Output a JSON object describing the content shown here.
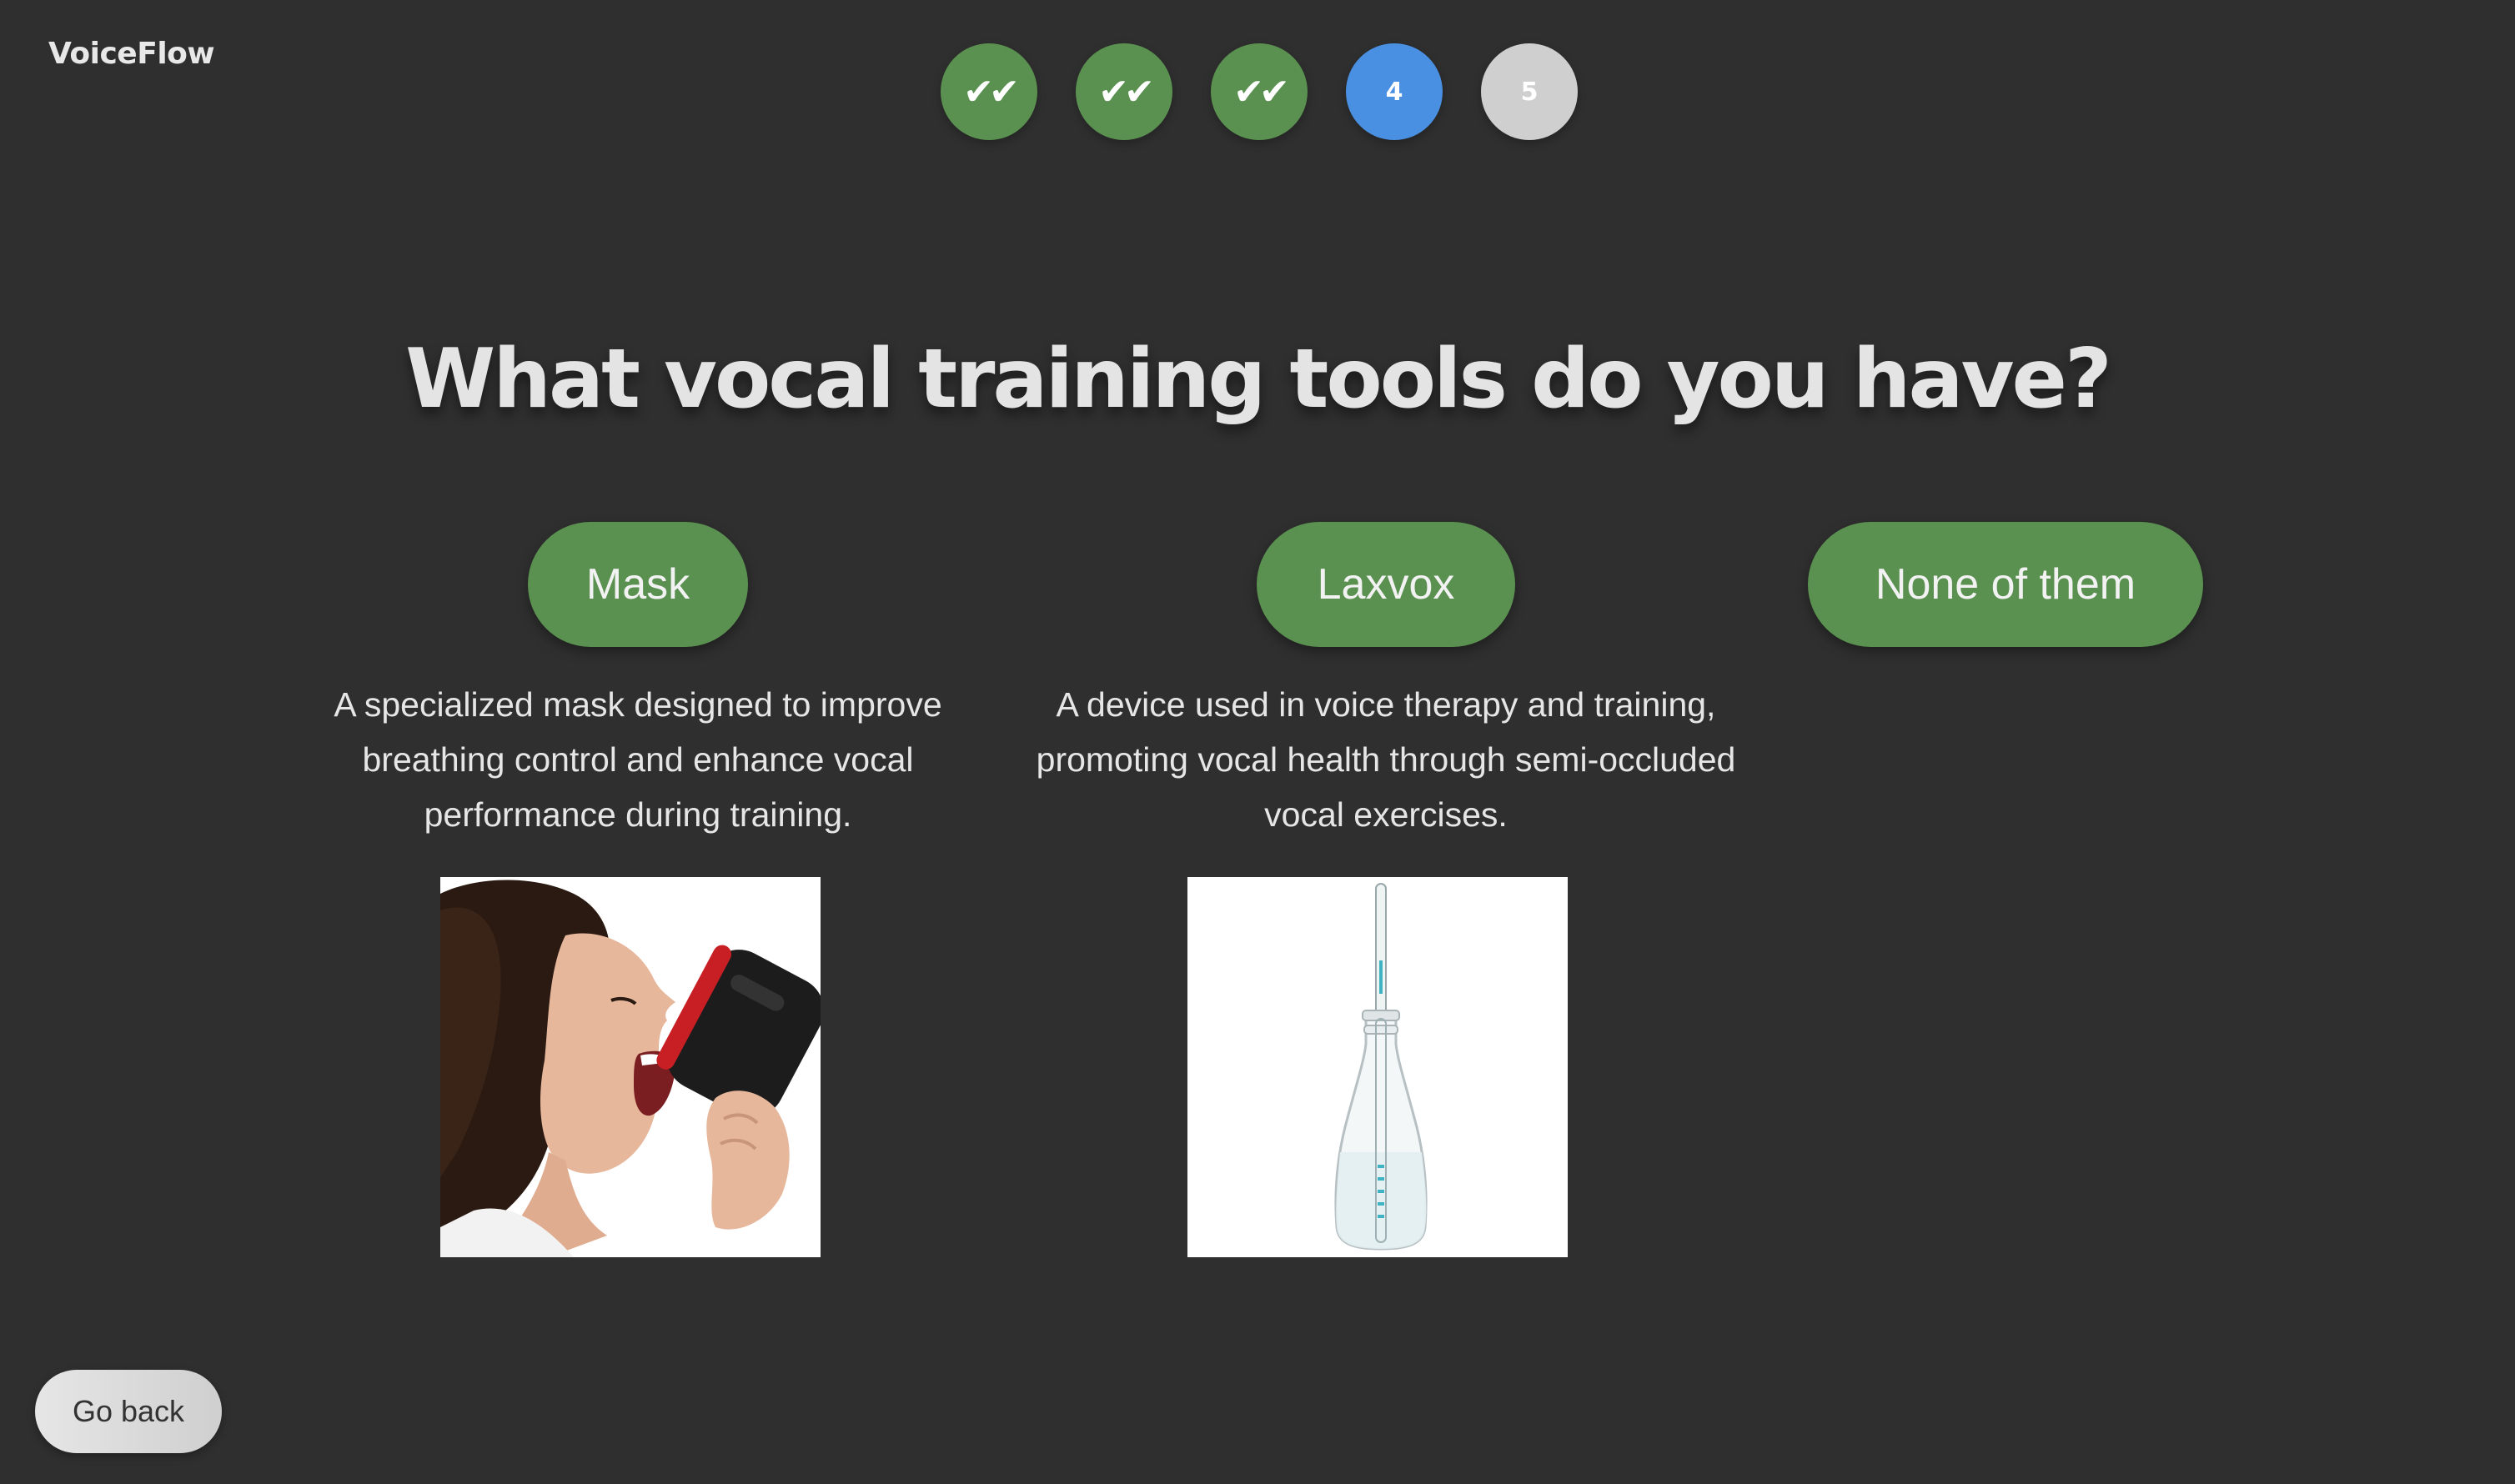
{
  "app": {
    "brand": "VoiceFlow"
  },
  "stepper": {
    "steps": [
      {
        "label": "✔✔",
        "state": "done"
      },
      {
        "label": "✔✔",
        "state": "done"
      },
      {
        "label": "✔✔",
        "state": "done"
      },
      {
        "label": "4",
        "state": "current"
      },
      {
        "label": "5",
        "state": "todo"
      }
    ]
  },
  "question": {
    "title": "What vocal training tools do you have?"
  },
  "options": [
    {
      "label": "Mask",
      "description": "A specialized mask designed to improve breathing control and enhance vocal performance during training.",
      "image": "breathing-mask"
    },
    {
      "label": "Laxvox",
      "description": "A device used in voice therapy and training, promoting vocal health through semi-occluded vocal exercises.",
      "image": "laxvox-bottle"
    },
    {
      "label": "None of them"
    }
  ],
  "footer": {
    "back_label": "Go back"
  },
  "colors": {
    "background": "#2f2f2f",
    "option_green": "#5a9150",
    "step_done": "#5a9150",
    "step_current": "#4a90e2",
    "step_todo": "#cfcfcf"
  }
}
